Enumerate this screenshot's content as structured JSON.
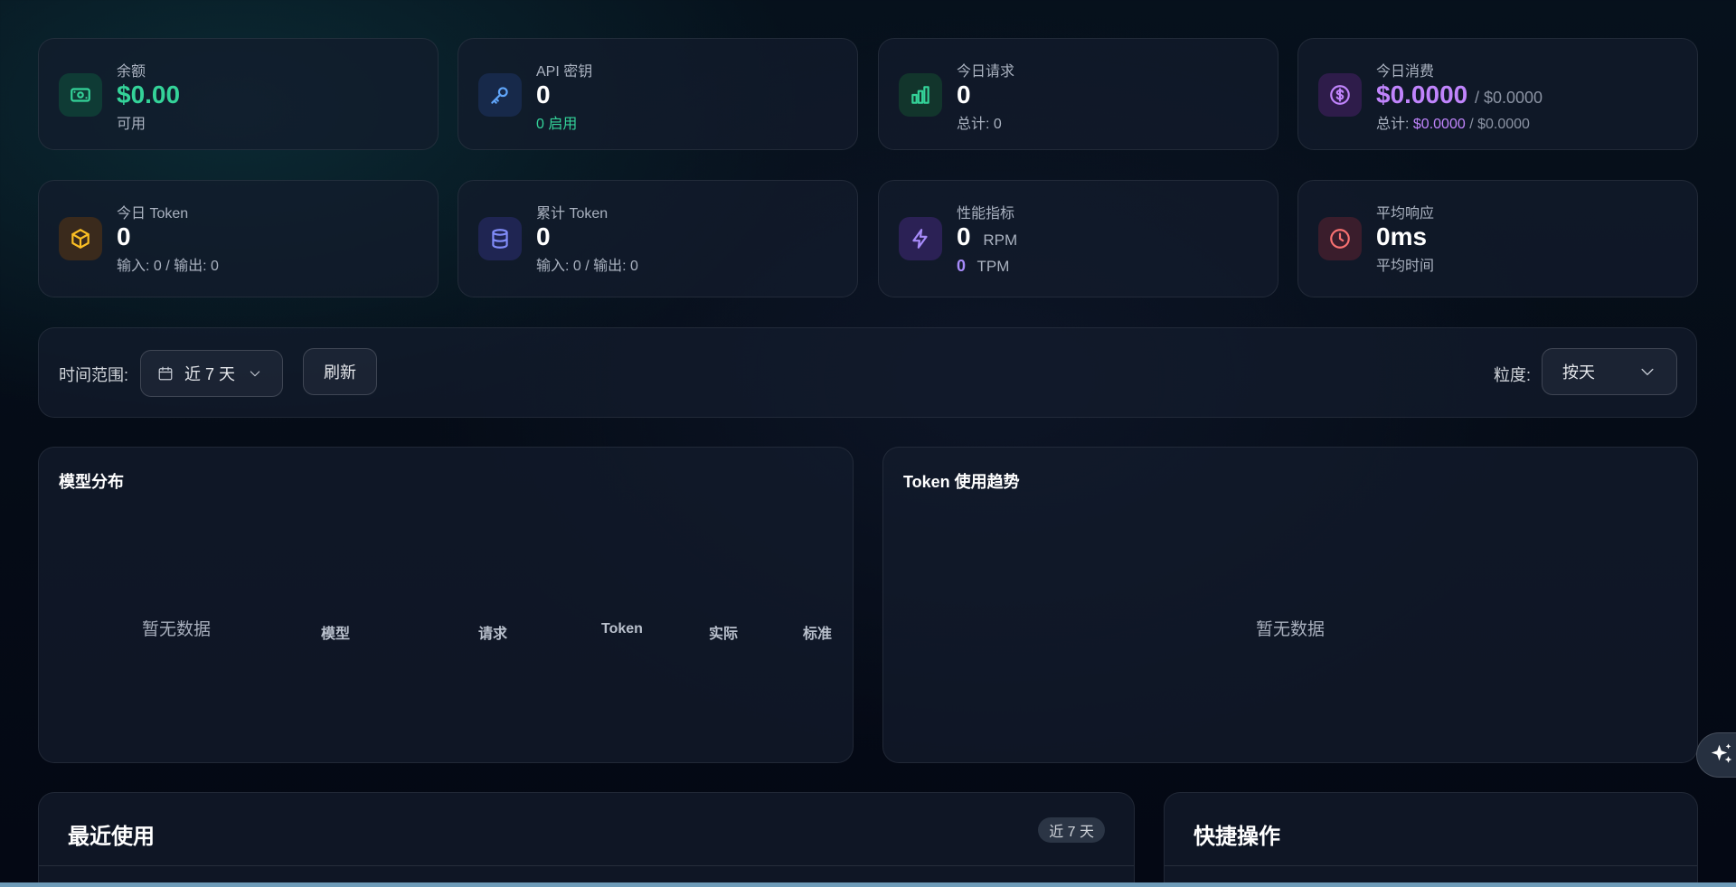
{
  "stats_row1": [
    {
      "label": "余额",
      "value": "$0.00",
      "sub": "可用",
      "icon": "money-icon"
    },
    {
      "label": "API 密钥",
      "value": "0",
      "sub": "0 启用",
      "icon": "key-icon"
    },
    {
      "label": "今日请求",
      "value": "0",
      "sub": "总计: 0",
      "icon": "bar-chart-icon"
    },
    {
      "label": "今日消费",
      "value": "$0.0000",
      "value_suffix": "/ $0.0000",
      "sub_prefix": "总计: ",
      "sub_value": "$0.0000",
      "sub_suffix": " / $0.0000",
      "icon": "dollar-circle-icon"
    }
  ],
  "stats_row2": [
    {
      "label": "今日 Token",
      "value": "0",
      "sub": "输入: 0 / 输出: 0",
      "icon": "cube-icon"
    },
    {
      "label": "累计 Token",
      "value": "0",
      "sub": "输入: 0 / 输出: 0",
      "icon": "database-icon"
    },
    {
      "label": "性能指标",
      "value": "0",
      "value_unit": "RPM",
      "sub_value": "0",
      "sub_unit": "TPM",
      "icon": "lightning-icon"
    },
    {
      "label": "平均响应",
      "value": "0ms",
      "sub": "平均时间",
      "icon": "clock-icon"
    }
  ],
  "filter": {
    "time_range_label": "时间范围:",
    "time_range_value": "近 7 天",
    "refresh_label": "刷新",
    "granularity_label": "粒度:",
    "granularity_value": "按天"
  },
  "model_panel": {
    "title": "模型分布",
    "empty": "暂无数据",
    "columns": [
      "模型",
      "请求",
      "Token",
      "实际",
      "标准"
    ]
  },
  "token_panel": {
    "title": "Token 使用趋势",
    "empty": "暂无数据"
  },
  "recent": {
    "title": "最近使用",
    "badge": "近 7 天"
  },
  "quick": {
    "title": "快捷操作"
  },
  "colors": {
    "accent_green": "#34d399",
    "accent_purple": "#c084fc"
  }
}
